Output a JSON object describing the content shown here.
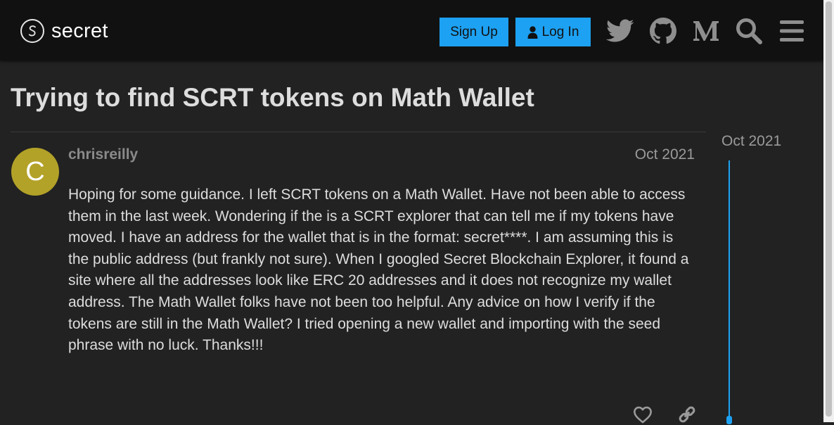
{
  "header": {
    "logo_text": "secret",
    "signup_label": "Sign Up",
    "login_label": "Log In",
    "icons": [
      "twitter-icon",
      "github-icon",
      "medium-icon",
      "search-icon",
      "hamburger-menu-icon"
    ]
  },
  "topic": {
    "title": "Trying to find SCRT tokens on Math Wallet"
  },
  "post": {
    "avatar_letter": "C",
    "avatar_color": "#b3a228",
    "username": "chrisreilly",
    "date": "Oct 2021",
    "body": "Hoping for some guidance. I left SCRT tokens on a Math Wallet. Have not been able to access them in the last week. Wondering if the is a SCRT explorer that can tell me if my tokens have moved. I have an address for the wallet that is in the format: secret****. I am assuming this is the public address (but frankly not sure). When I googled Secret Blockchain Explorer, it found a site where all the addresses look like ERC 20 addresses and it does not recognize my wallet address. The Math Wallet folks have not been too helpful. Any advice on how I verify if the tokens are still in the Math Wallet? I tried opening a new wallet and importing with the seed phrase with no luck. Thanks!!!",
    "actions": [
      "like-heart-icon",
      "share-link-icon"
    ]
  },
  "timeline": {
    "date": "Oct 2021"
  },
  "colors": {
    "accent": "#1da1f2",
    "background": "#222222",
    "header_background": "#111111"
  }
}
